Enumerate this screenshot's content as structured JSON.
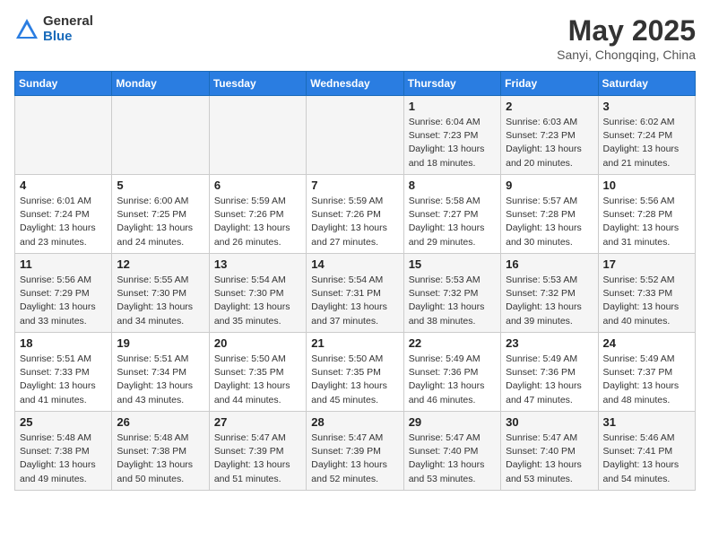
{
  "header": {
    "logo_general": "General",
    "logo_blue": "Blue",
    "title": "May 2025",
    "location": "Sanyi, Chongqing, China"
  },
  "days_of_week": [
    "Sunday",
    "Monday",
    "Tuesday",
    "Wednesday",
    "Thursday",
    "Friday",
    "Saturday"
  ],
  "weeks": [
    [
      {
        "day": "",
        "info": ""
      },
      {
        "day": "",
        "info": ""
      },
      {
        "day": "",
        "info": ""
      },
      {
        "day": "",
        "info": ""
      },
      {
        "day": "1",
        "info": "Sunrise: 6:04 AM\nSunset: 7:23 PM\nDaylight: 13 hours\nand 18 minutes."
      },
      {
        "day": "2",
        "info": "Sunrise: 6:03 AM\nSunset: 7:23 PM\nDaylight: 13 hours\nand 20 minutes."
      },
      {
        "day": "3",
        "info": "Sunrise: 6:02 AM\nSunset: 7:24 PM\nDaylight: 13 hours\nand 21 minutes."
      }
    ],
    [
      {
        "day": "4",
        "info": "Sunrise: 6:01 AM\nSunset: 7:24 PM\nDaylight: 13 hours\nand 23 minutes."
      },
      {
        "day": "5",
        "info": "Sunrise: 6:00 AM\nSunset: 7:25 PM\nDaylight: 13 hours\nand 24 minutes."
      },
      {
        "day": "6",
        "info": "Sunrise: 5:59 AM\nSunset: 7:26 PM\nDaylight: 13 hours\nand 26 minutes."
      },
      {
        "day": "7",
        "info": "Sunrise: 5:59 AM\nSunset: 7:26 PM\nDaylight: 13 hours\nand 27 minutes."
      },
      {
        "day": "8",
        "info": "Sunrise: 5:58 AM\nSunset: 7:27 PM\nDaylight: 13 hours\nand 29 minutes."
      },
      {
        "day": "9",
        "info": "Sunrise: 5:57 AM\nSunset: 7:28 PM\nDaylight: 13 hours\nand 30 minutes."
      },
      {
        "day": "10",
        "info": "Sunrise: 5:56 AM\nSunset: 7:28 PM\nDaylight: 13 hours\nand 31 minutes."
      }
    ],
    [
      {
        "day": "11",
        "info": "Sunrise: 5:56 AM\nSunset: 7:29 PM\nDaylight: 13 hours\nand 33 minutes."
      },
      {
        "day": "12",
        "info": "Sunrise: 5:55 AM\nSunset: 7:30 PM\nDaylight: 13 hours\nand 34 minutes."
      },
      {
        "day": "13",
        "info": "Sunrise: 5:54 AM\nSunset: 7:30 PM\nDaylight: 13 hours\nand 35 minutes."
      },
      {
        "day": "14",
        "info": "Sunrise: 5:54 AM\nSunset: 7:31 PM\nDaylight: 13 hours\nand 37 minutes."
      },
      {
        "day": "15",
        "info": "Sunrise: 5:53 AM\nSunset: 7:32 PM\nDaylight: 13 hours\nand 38 minutes."
      },
      {
        "day": "16",
        "info": "Sunrise: 5:53 AM\nSunset: 7:32 PM\nDaylight: 13 hours\nand 39 minutes."
      },
      {
        "day": "17",
        "info": "Sunrise: 5:52 AM\nSunset: 7:33 PM\nDaylight: 13 hours\nand 40 minutes."
      }
    ],
    [
      {
        "day": "18",
        "info": "Sunrise: 5:51 AM\nSunset: 7:33 PM\nDaylight: 13 hours\nand 41 minutes."
      },
      {
        "day": "19",
        "info": "Sunrise: 5:51 AM\nSunset: 7:34 PM\nDaylight: 13 hours\nand 43 minutes."
      },
      {
        "day": "20",
        "info": "Sunrise: 5:50 AM\nSunset: 7:35 PM\nDaylight: 13 hours\nand 44 minutes."
      },
      {
        "day": "21",
        "info": "Sunrise: 5:50 AM\nSunset: 7:35 PM\nDaylight: 13 hours\nand 45 minutes."
      },
      {
        "day": "22",
        "info": "Sunrise: 5:49 AM\nSunset: 7:36 PM\nDaylight: 13 hours\nand 46 minutes."
      },
      {
        "day": "23",
        "info": "Sunrise: 5:49 AM\nSunset: 7:36 PM\nDaylight: 13 hours\nand 47 minutes."
      },
      {
        "day": "24",
        "info": "Sunrise: 5:49 AM\nSunset: 7:37 PM\nDaylight: 13 hours\nand 48 minutes."
      }
    ],
    [
      {
        "day": "25",
        "info": "Sunrise: 5:48 AM\nSunset: 7:38 PM\nDaylight: 13 hours\nand 49 minutes."
      },
      {
        "day": "26",
        "info": "Sunrise: 5:48 AM\nSunset: 7:38 PM\nDaylight: 13 hours\nand 50 minutes."
      },
      {
        "day": "27",
        "info": "Sunrise: 5:47 AM\nSunset: 7:39 PM\nDaylight: 13 hours\nand 51 minutes."
      },
      {
        "day": "28",
        "info": "Sunrise: 5:47 AM\nSunset: 7:39 PM\nDaylight: 13 hours\nand 52 minutes."
      },
      {
        "day": "29",
        "info": "Sunrise: 5:47 AM\nSunset: 7:40 PM\nDaylight: 13 hours\nand 53 minutes."
      },
      {
        "day": "30",
        "info": "Sunrise: 5:47 AM\nSunset: 7:40 PM\nDaylight: 13 hours\nand 53 minutes."
      },
      {
        "day": "31",
        "info": "Sunrise: 5:46 AM\nSunset: 7:41 PM\nDaylight: 13 hours\nand 54 minutes."
      }
    ]
  ]
}
